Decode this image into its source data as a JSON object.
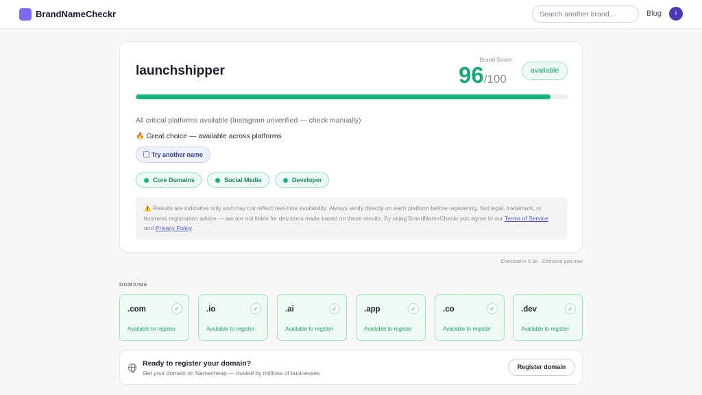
{
  "header": {
    "logo_text": "BrandNameCheckr",
    "search_placeholder": "Search another brand...",
    "blog_label": "Blog",
    "avatar_initial": "i"
  },
  "result": {
    "brand_name": "launchshipper",
    "score_label": "Brand Score:",
    "score_value": "96",
    "score_max": "/100",
    "score_fraction": 0.96,
    "status_label": "available",
    "summary": "All critical platforms available (Instagram unverified — check manually)",
    "verdict": "Great choice — available across platforms",
    "try_another_label": "Try another name",
    "filters": [
      "Core Domains",
      "Social Media",
      "Developer"
    ],
    "disclaimer": {
      "text": "Results are indicative only and may not reflect real-time availability. Always verify directly on each platform before registering. Not legal, trademark, or business registration advice — we are not liable for decisions made based on these results. By using BrandNameCheckr you agree to our",
      "terms_label": "Terms of Service",
      "and_text": "and",
      "privacy_label": "Privacy Policy",
      "end": "."
    }
  },
  "meta": {
    "checked": "Checked in 5.3s · Checked just now"
  },
  "domains": {
    "section_title": "DOMAINS",
    "items": [
      {
        "tld": ".com",
        "status": "Available to register"
      },
      {
        "tld": ".io",
        "status": "Available to register"
      },
      {
        "tld": ".ai",
        "status": "Available to register"
      },
      {
        "tld": ".app",
        "status": "Available to register"
      },
      {
        "tld": ".co",
        "status": "Available to register"
      },
      {
        "tld": ".dev",
        "status": "Available to register"
      }
    ]
  },
  "register": {
    "title": "Ready to register your domain?",
    "subtitle": "Get your domain on Namecheap — trusted by millions of businesses",
    "button_label": "Register domain"
  },
  "colors": {
    "accent_green": "#18b27b",
    "logo_purple": "#7c6cf2",
    "avatar": "#4a3ab6"
  }
}
